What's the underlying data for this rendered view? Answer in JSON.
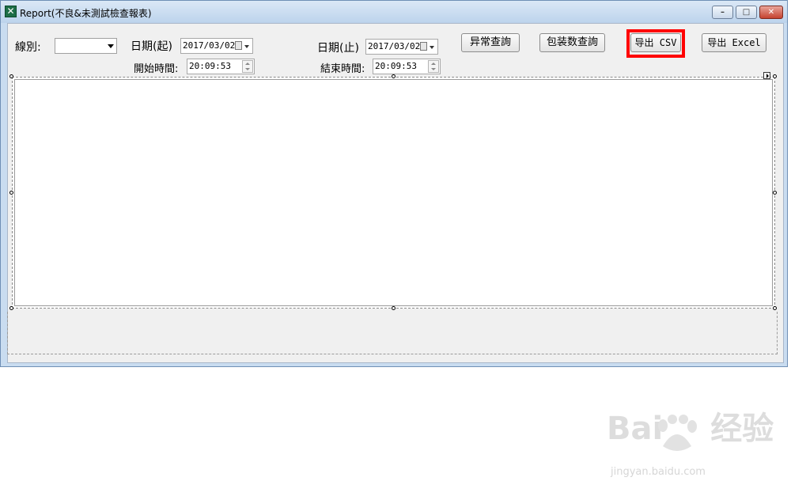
{
  "window": {
    "title": "Report(不良&未測試檢查報表)",
    "controls": {
      "minimize": "–",
      "maximize": "□",
      "close": "✕"
    }
  },
  "form": {
    "line_label": "線別:",
    "line_value": "",
    "date_start_label": "日期(起)",
    "date_start_value": "2017/03/02",
    "date_end_label": "日期(止)",
    "date_end_value": "2017/03/02",
    "start_time_label": "開始時間:",
    "start_time_value": "20:09:53",
    "end_time_label": "結束時間:",
    "end_time_value": "20:09:53"
  },
  "buttons": {
    "abnormal_query": "异常查詢",
    "package_query": "包装数查詢",
    "export_csv": "导出 CSV",
    "export_excel": "导出 Excel"
  },
  "watermark": {
    "brand": "Bai",
    "brand_suffix": "经验",
    "url": "jingyan.baidu.com"
  },
  "colors": {
    "highlight": "#ff0000",
    "window_frame": "#c9dcf0",
    "client_bg": "#f0f0f0"
  }
}
